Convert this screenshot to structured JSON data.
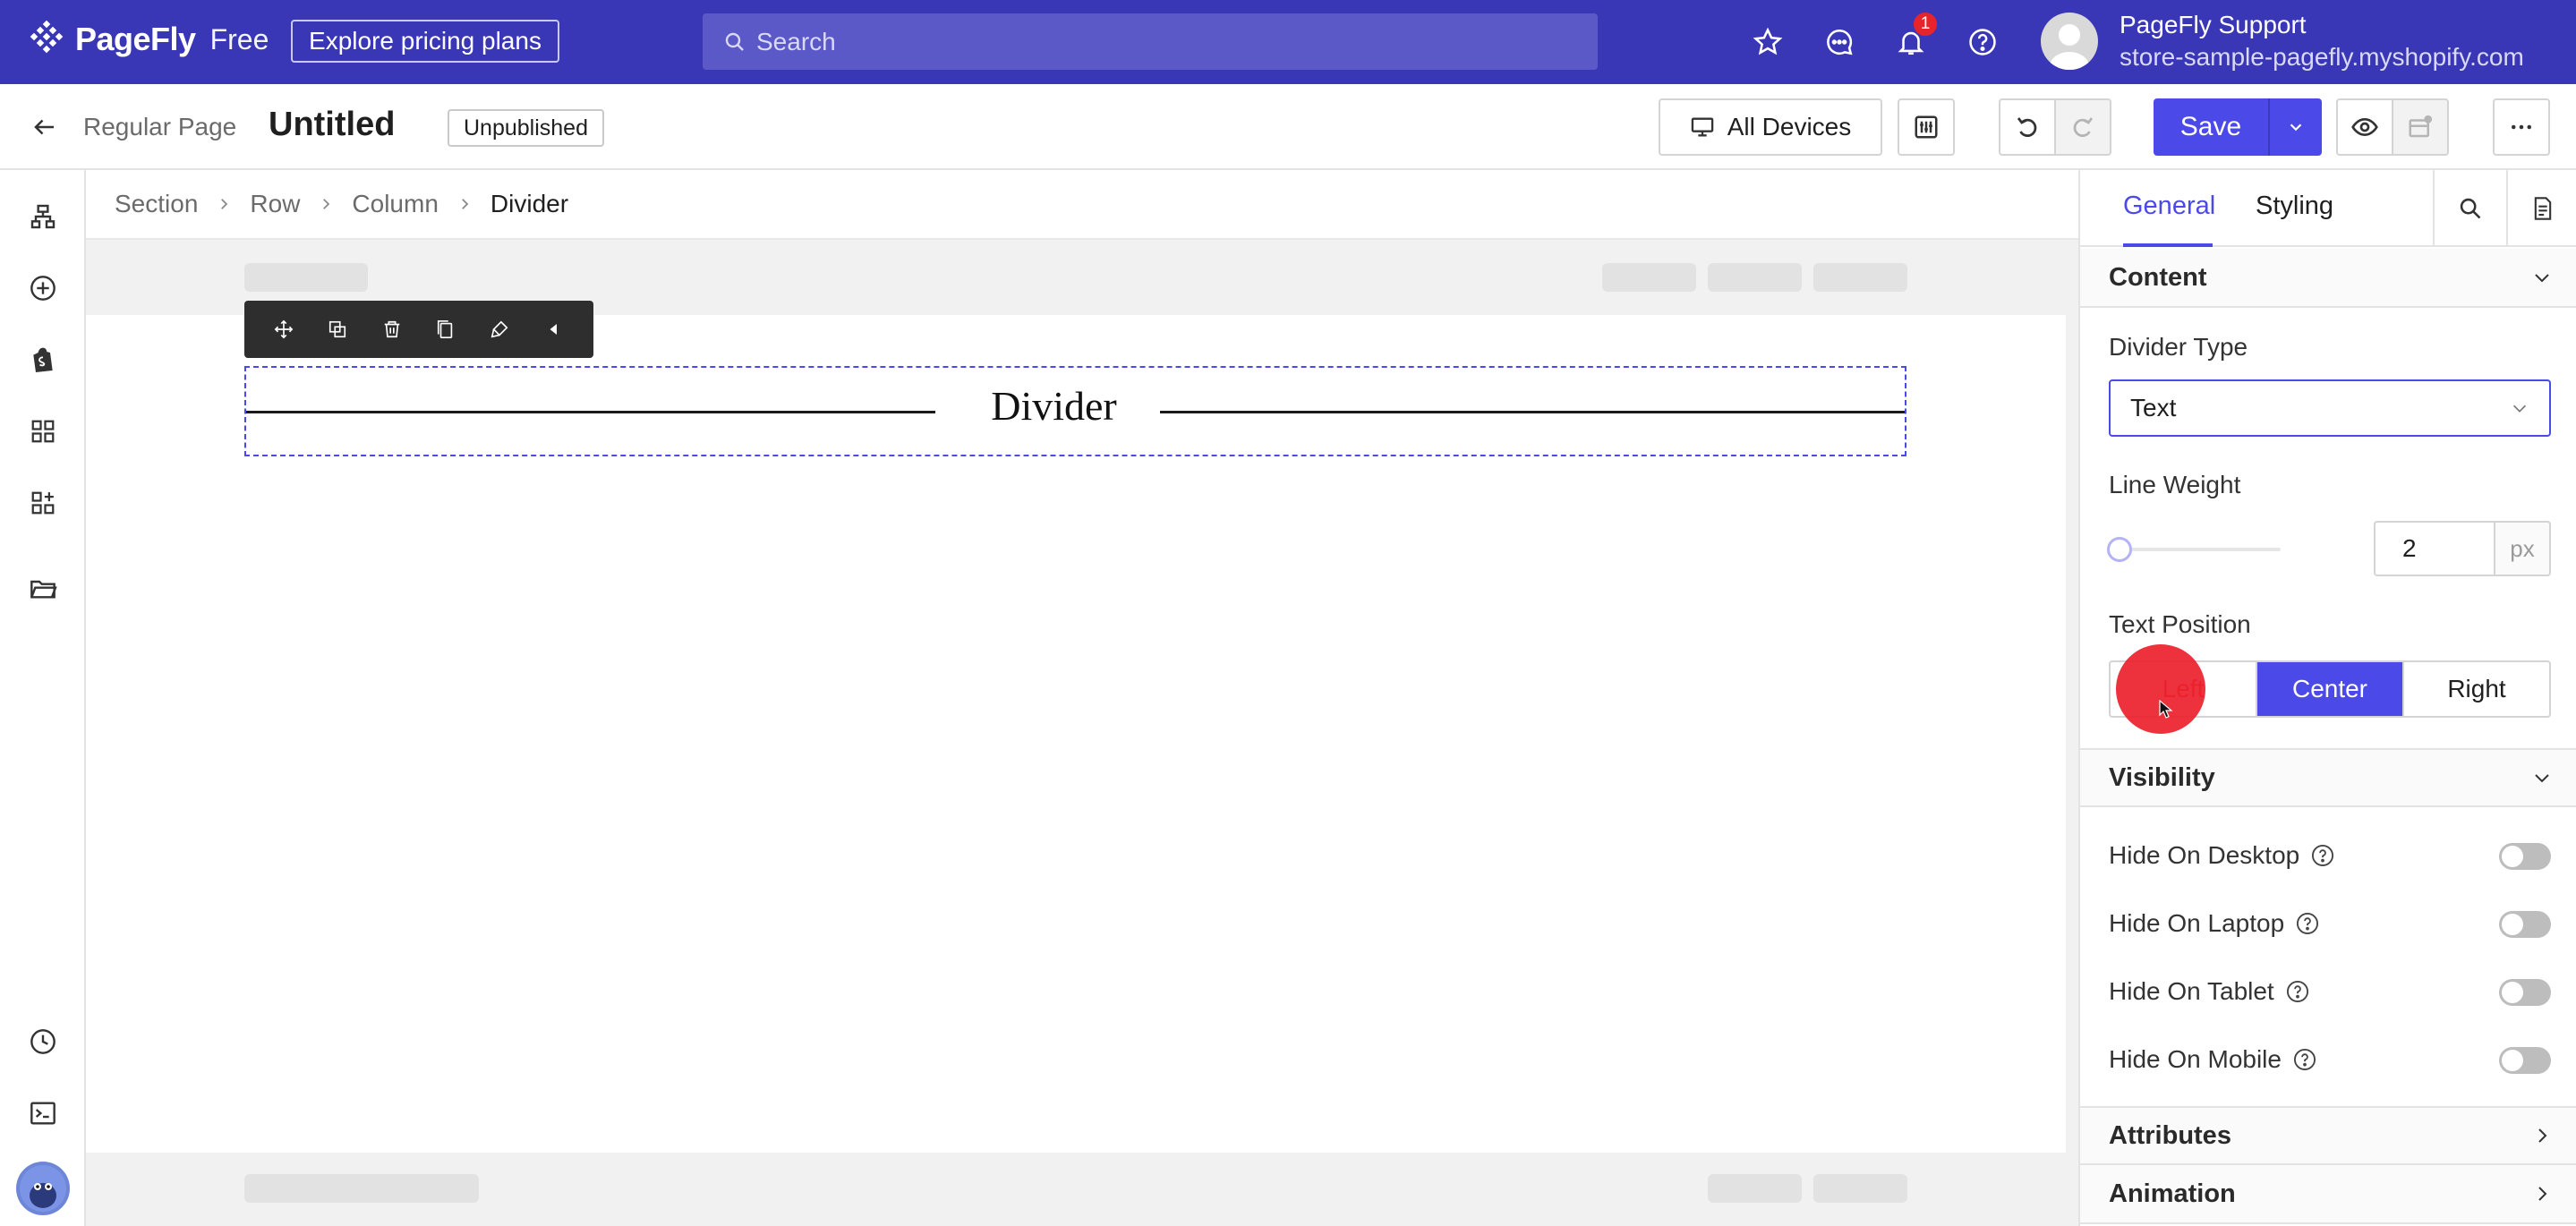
{
  "topbar": {
    "brand": "PageFly",
    "plan": "Free",
    "pricing_label": "Explore pricing plans",
    "search_placeholder": "Search",
    "notification_count": "1",
    "user_name": "PageFly Support",
    "store_url": "store-sample-pagefly.myshopify.com",
    "icons": [
      "star-icon",
      "chat-icon",
      "bell-icon",
      "help-icon"
    ]
  },
  "pagebar": {
    "page_type": "Regular Page",
    "title": "Untitled",
    "status": "Unpublished",
    "devices_label": "All Devices",
    "save_label": "Save"
  },
  "leftrail": {
    "icons": [
      "layers-icon",
      "add-icon",
      "shopify-icon",
      "grid-icon",
      "add-grid-icon",
      "folder-icon",
      "history-icon",
      "terminal-icon",
      "avatar-icon"
    ]
  },
  "breadcrumb": {
    "items": [
      "Section",
      "Row",
      "Column",
      "Divider"
    ]
  },
  "canvas": {
    "divider_text": "Divider",
    "toolbar_icons": [
      "move-icon",
      "duplicate-icon",
      "delete-icon",
      "copy-icon",
      "paint-icon",
      "collapse-icon"
    ]
  },
  "panel": {
    "tabs": [
      "General",
      "Styling"
    ],
    "content_header": "Content",
    "divider_type_label": "Divider Type",
    "divider_type_value": "Text",
    "line_weight_label": "Line Weight",
    "line_weight_value": "2",
    "line_weight_unit": "px",
    "line_weight_level": 0.0,
    "text_position_label": "Text Position",
    "text_positions": [
      "Left",
      "Center",
      "Right"
    ],
    "text_position_selected": "Center",
    "visibility_header": "Visibility",
    "visibility_items": [
      {
        "label": "Hide On Desktop",
        "on": false
      },
      {
        "label": "Hide On Laptop",
        "on": false
      },
      {
        "label": "Hide On Tablet",
        "on": false
      },
      {
        "label": "Hide On Mobile",
        "on": false
      }
    ],
    "attributes_header": "Attributes",
    "animation_header": "Animation"
  },
  "colors": {
    "topbar": "#3a37b6",
    "accent": "#4b4ae8",
    "click_indicator": "#ec202c"
  }
}
